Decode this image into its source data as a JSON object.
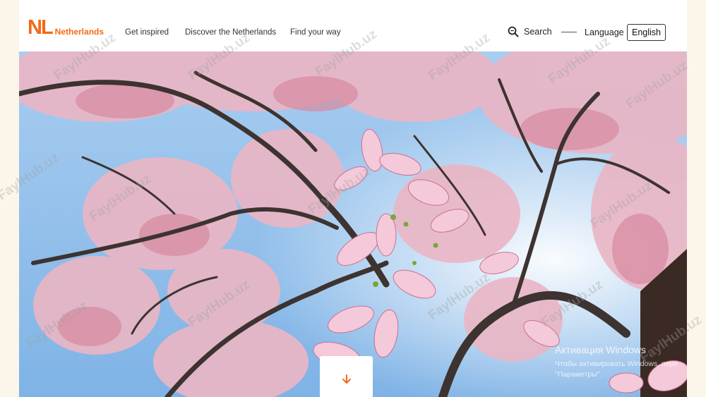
{
  "header": {
    "logo_mark": "NL",
    "logo_text": "Netherlands",
    "nav": [
      "Get inspired",
      "Discover the Netherlands",
      "Find your way"
    ],
    "search_label": "Search",
    "language_label": "Language",
    "language_value": "English"
  },
  "hero": {
    "scroll_icon": "arrow-down-icon"
  },
  "os_watermark": {
    "title": "Активация Windows",
    "line1": "Чтобы активировать Windows, пере",
    "line2": "\"Параметры\"."
  },
  "site_watermark": "FaylHub.uz",
  "colors": {
    "brand_orange": "#f26b16",
    "sky": "#9cc6ee",
    "blossom": "#eeb3c6",
    "branch": "#3d3330"
  }
}
